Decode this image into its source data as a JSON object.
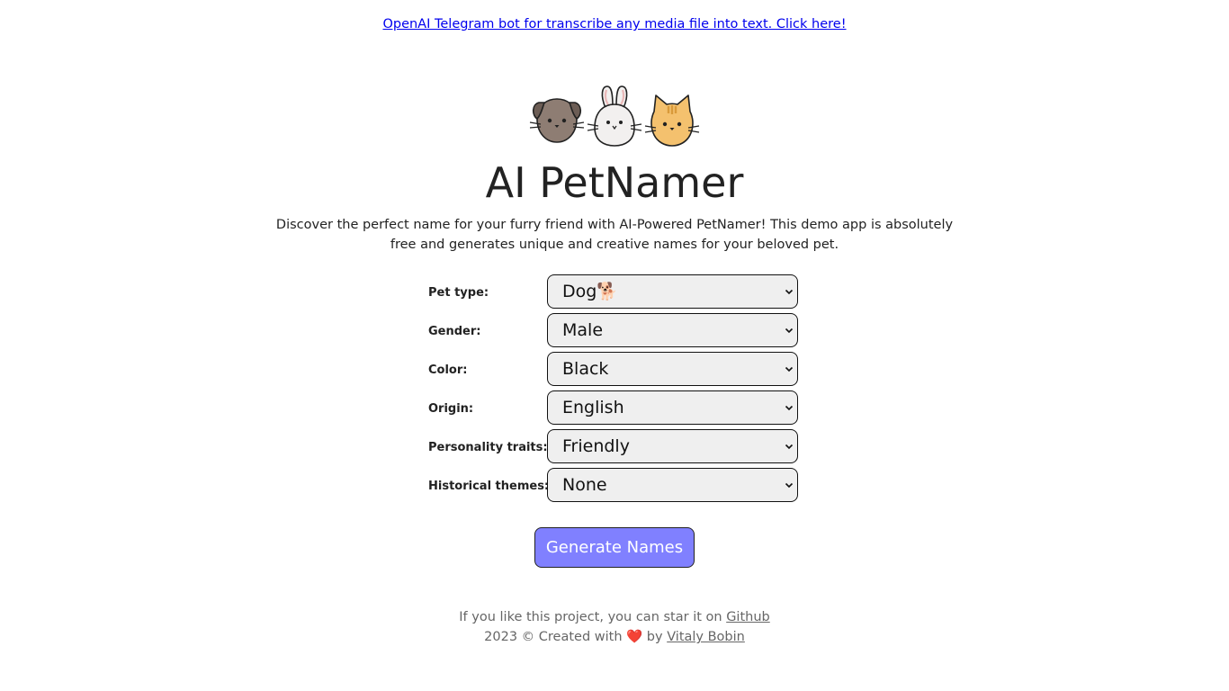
{
  "promo": {
    "link_text": "OpenAI Telegram bot for transcribe any media file into text. Click here!"
  },
  "hero": {
    "icons": [
      "dog-icon",
      "rabbit-icon",
      "cat-icon"
    ],
    "title": "AI PetNamer",
    "description": "Discover the perfect name for your furry friend with AI-Powered PetNamer! This demo app is absolutely free and generates unique and creative names for your beloved pet."
  },
  "form": {
    "fields": [
      {
        "label": "Pet type:",
        "value": "Dog🐕"
      },
      {
        "label": "Gender:",
        "value": "Male"
      },
      {
        "label": "Color:",
        "value": "Black"
      },
      {
        "label": "Origin:",
        "value": "English"
      },
      {
        "label": "Personality traits:",
        "value": "Friendly"
      },
      {
        "label": "Historical themes:",
        "value": "None"
      }
    ],
    "submit_label": "Generate Names"
  },
  "footer": {
    "star_text": "If you like this project, you can star it on ",
    "github_link": "Github",
    "credit_text": "2023 © Created with ❤️ by ",
    "author_link": "Vitaly Bobin"
  },
  "colors": {
    "button_bg": "#8080ff",
    "link": "#0000ee",
    "footer_text": "#666666"
  }
}
